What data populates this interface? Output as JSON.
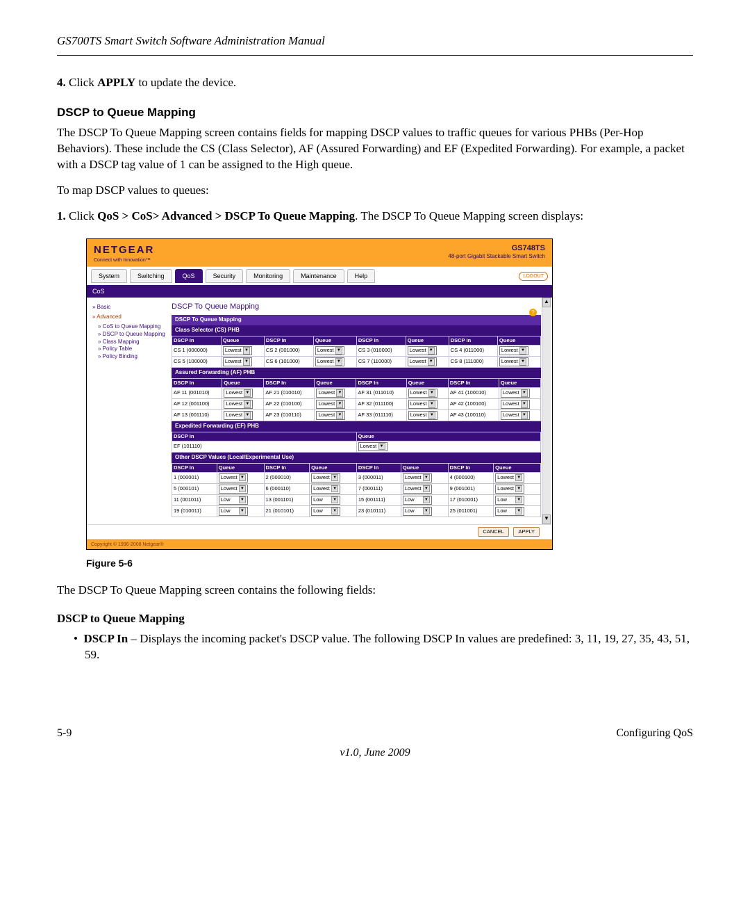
{
  "header": {
    "title": "GS700TS Smart Switch Software Administration Manual"
  },
  "step4": {
    "num": "4.",
    "pre": "Click ",
    "bold": "APPLY",
    "post": " to update the device."
  },
  "h_section": "DSCP to Queue Mapping",
  "para1": "The DSCP To Queue Mapping screen contains fields for mapping DSCP values to traffic queues for various PHBs (Per-Hop Behaviors). These include the CS (Class Selector), AF (Assured Forwarding) and EF (Expedited Forwarding). For example, a packet with a DSCP tag value of 1 can be assigned to the High queue.",
  "para2": "To map DSCP values to queues:",
  "step1": {
    "num": "1.",
    "pre": "Click ",
    "bold": "QoS > CoS> Advanced > DSCP To Queue Mapping",
    "post": ". The DSCP To Queue Mapping screen displays:"
  },
  "screenshot": {
    "logo": "NETGEAR",
    "logo_sub": "Connect with Innovation™",
    "model": "GS748TS",
    "model_sub": "48-port Gigabit Stackable Smart Switch",
    "tabs": [
      "System",
      "Switching",
      "QoS",
      "Security",
      "Monitoring",
      "Maintenance",
      "Help"
    ],
    "active_tab": "QoS",
    "logout": "LOGOUT",
    "subtab": "CoS",
    "leftnav": {
      "basic": "Basic",
      "advanced": "Advanced",
      "items": [
        "CoS to Queue Mapping",
        "DSCP to Queue Mapping",
        "Class Mapping",
        "Policy Table",
        "Policy Binding"
      ],
      "current": "DSCP to Queue Mapping"
    },
    "panel_title": "DSCP To Queue Mapping",
    "box_title": "DSCP To Queue Mapping",
    "col_dscp": "DSCP In",
    "col_queue": "Queue",
    "queue_lowest": "Lowest",
    "queue_low": "Low",
    "cs": {
      "title": "Class Selector (CS) PHB",
      "rows": [
        [
          "CS 1 (000000)",
          "CS 2 (001000)",
          "CS 3 (010000)",
          "CS 4 (011000)"
        ],
        [
          "CS 5 (100000)",
          "CS 6 (101000)",
          "CS 7 (110000)",
          "CS 8 (111000)"
        ]
      ]
    },
    "af": {
      "title": "Assured Forwarding (AF) PHB",
      "rows": [
        [
          "AF 11 (001010)",
          "AF 21 (010010)",
          "AF 31 (011010)",
          "AF 41 (100010)"
        ],
        [
          "AF 12 (001100)",
          "AF 22 (010100)",
          "AF 32 (011100)",
          "AF 42 (100100)"
        ],
        [
          "AF 13 (001110)",
          "AF 23 (010110)",
          "AF 33 (011110)",
          "AF 43 (100110)"
        ]
      ]
    },
    "ef": {
      "title": "Expedited Forwarding (EF) PHB",
      "label": "EF (101110)"
    },
    "other": {
      "title": "Other DSCP Values (Local/Experimental Use)",
      "rows": [
        {
          "cells": [
            "1 (000001)",
            "2 (000010)",
            "3 (000011)",
            "4 (000100)"
          ],
          "q": "Lowest"
        },
        {
          "cells": [
            "5 (000101)",
            "6 (000110)",
            "7 (000111)",
            "9 (001001)"
          ],
          "q": "Lowest"
        },
        {
          "cells": [
            "11 (001011)",
            "13 (001101)",
            "15 (001111)",
            "17 (010001)"
          ],
          "q": "Low"
        },
        {
          "cells": [
            "19 (010011)",
            "21 (010101)",
            "23 (010111)",
            "25 (011001)"
          ],
          "q": "Low"
        }
      ]
    },
    "btn_cancel": "CANCEL",
    "btn_apply": "APPLY",
    "copyright": "Copyright © 1996-2008 Netgear®"
  },
  "figure_caption": "Figure 5-6",
  "para3": "The DSCP To Queue Mapping screen contains the following fields:",
  "h_fields": "DSCP to Queue Mapping",
  "bullet1": {
    "label": "DSCP In",
    "rest": " – Displays the incoming packet's DSCP value. The following DSCP In values are predefined: 3, 11, 19, 27, 35, 43, 51, 59."
  },
  "footer": {
    "left": "5-9",
    "right": "Configuring QoS",
    "center": "v1.0, June 2009"
  }
}
